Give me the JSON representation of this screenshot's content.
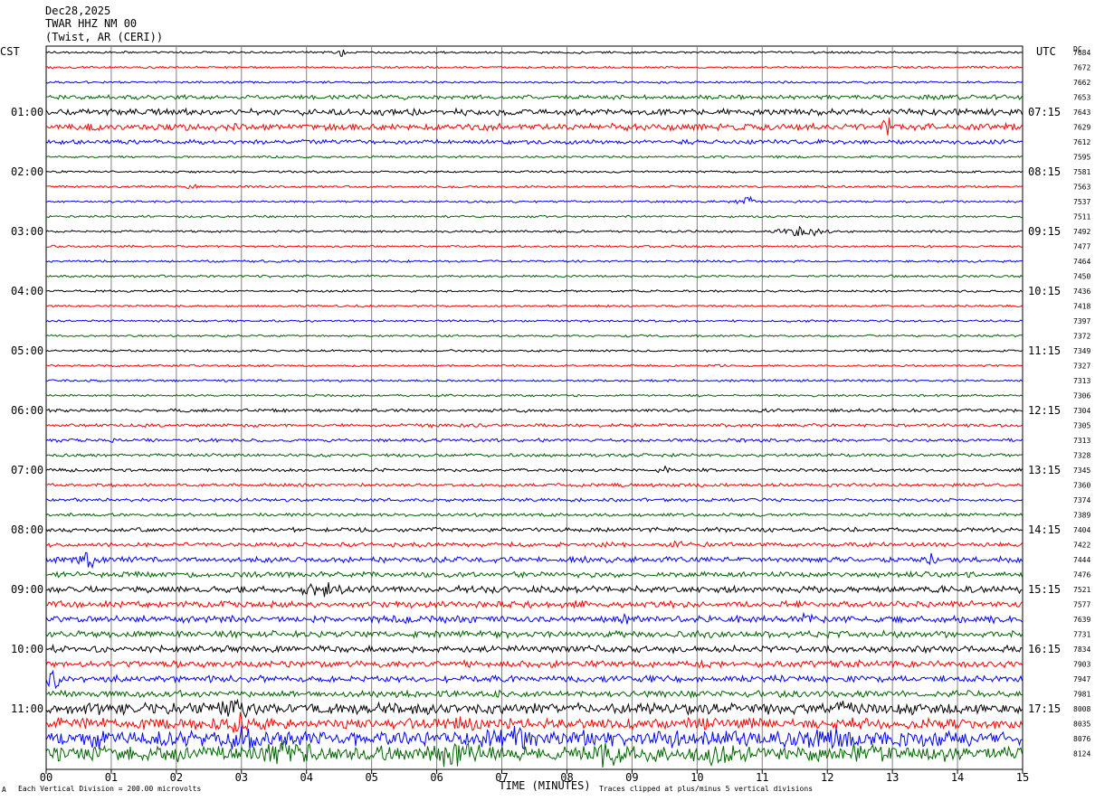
{
  "header": {
    "date": "Dec28,2025",
    "station": "TWAR HHZ NM 00",
    "location": "(Twist, AR (CERI))"
  },
  "left_zone": "CST",
  "right_zone": "UTC",
  "dc_label": "DC",
  "footer": {
    "scale": "Each Vertical Division =  200.00 microvolts",
    "clip": "Traces clipped at plus/minus 5 vertical divisions",
    "corner": "A"
  },
  "colors": {
    "cycle": [
      "#000000",
      "#ff0000",
      "#0000ff",
      "#006400"
    ],
    "grid": "#808080"
  },
  "chart_data": {
    "type": "line",
    "xlabel": "TIME (MINUTES)",
    "xlim": [
      0,
      15
    ],
    "x_ticks": [
      "00",
      "01",
      "02",
      "03",
      "04",
      "05",
      "06",
      "07",
      "08",
      "09",
      "10",
      "11",
      "12",
      "13",
      "14",
      "15"
    ],
    "left_hour_labels": [
      "01:00",
      "02:00",
      "03:00",
      "04:00",
      "05:00",
      "06:00",
      "07:00",
      "08:00",
      "09:00",
      "10:00",
      "11:00"
    ],
    "right_hour_labels": [
      "07:15",
      "08:15",
      "09:15",
      "10:15",
      "11:15",
      "12:15",
      "13:15",
      "14:15",
      "15:15",
      "16:15",
      "17:15"
    ],
    "hour_label_rows": [
      4,
      8,
      12,
      16,
      20,
      24,
      28,
      32,
      36,
      40,
      44
    ],
    "dc_offsets": [
      "7684",
      "7672",
      "7662",
      "7653",
      "7643",
      "7629",
      "7612",
      "7595",
      "7581",
      "7563",
      "7537",
      "7511",
      "7492",
      "7477",
      "7464",
      "7450",
      "7436",
      "7418",
      "7397",
      "7372",
      "7349",
      "7327",
      "7313",
      "7306",
      "7304",
      "7305",
      "7313",
      "7328",
      "7345",
      "7360",
      "7374",
      "7389",
      "7404",
      "7422",
      "7444",
      "7476",
      "7521",
      "7577",
      "7639",
      "7731",
      "7834",
      "7903",
      "7947",
      "7981",
      "8008",
      "8035",
      "8076",
      "8124"
    ],
    "noise_levels": [
      1,
      1,
      1,
      2,
      3,
      3,
      2,
      1,
      1,
      1,
      1,
      1,
      1,
      1,
      1,
      1,
      1,
      1,
      1,
      1,
      1,
      1,
      1,
      1,
      1.5,
      1.5,
      1.5,
      1.5,
      1.5,
      1.5,
      1.5,
      1.5,
      2,
      2,
      2.5,
      2.5,
      3,
      3,
      3,
      3,
      3,
      3,
      3,
      3,
      5,
      5,
      7,
      7
    ],
    "events": [
      {
        "row": 0,
        "t": 4.55,
        "amp": 6,
        "dur": 0.15
      },
      {
        "row": 5,
        "t": 0.7,
        "amp": 5,
        "dur": 0.8
      },
      {
        "row": 5,
        "t": 4.8,
        "amp": 5,
        "dur": 0.4
      },
      {
        "row": 5,
        "t": 12.9,
        "amp": 28,
        "dur": 0.1
      },
      {
        "row": 5,
        "t": 14.8,
        "amp": 6,
        "dur": 0.2
      },
      {
        "row": 9,
        "t": 2.2,
        "amp": 4,
        "dur": 0.3
      },
      {
        "row": 10,
        "t": 10.8,
        "amp": 7,
        "dur": 0.3
      },
      {
        "row": 12,
        "t": 11.6,
        "amp": 9,
        "dur": 0.6
      },
      {
        "row": 25,
        "t": 5.9,
        "amp": 4,
        "dur": 0.1
      },
      {
        "row": 25,
        "t": 7.6,
        "amp": 5,
        "dur": 0.1
      },
      {
        "row": 26,
        "t": 1.0,
        "amp": 5,
        "dur": 0.1
      },
      {
        "row": 26,
        "t": 7.6,
        "amp": 4,
        "dur": 0.1
      },
      {
        "row": 28,
        "t": 9.5,
        "amp": 6,
        "dur": 0.3
      },
      {
        "row": 29,
        "t": 8.9,
        "amp": 4,
        "dur": 0.2
      },
      {
        "row": 33,
        "t": 9.7,
        "amp": 6,
        "dur": 0.2
      },
      {
        "row": 34,
        "t": 0.65,
        "amp": 14,
        "dur": 0.3
      },
      {
        "row": 34,
        "t": 13.6,
        "amp": 9,
        "dur": 0.2
      },
      {
        "row": 36,
        "t": 4.3,
        "amp": 10,
        "dur": 0.8
      },
      {
        "row": 37,
        "t": 1.4,
        "amp": 6,
        "dur": 0.5
      },
      {
        "row": 37,
        "t": 8.2,
        "amp": 8,
        "dur": 0.3
      },
      {
        "row": 38,
        "t": 8.95,
        "amp": 18,
        "dur": 0.2
      },
      {
        "row": 38,
        "t": 11.7,
        "amp": 10,
        "dur": 0.3
      },
      {
        "row": 38,
        "t": 5.5,
        "amp": 7,
        "dur": 0.3
      },
      {
        "row": 40,
        "t": 0.3,
        "amp": 8,
        "dur": 0.1
      },
      {
        "row": 40,
        "t": 13.5,
        "amp": 6,
        "dur": 0.2
      },
      {
        "row": 41,
        "t": 11.1,
        "amp": 7,
        "dur": 0.2
      },
      {
        "row": 42,
        "t": 0.1,
        "amp": 18,
        "dur": 0.2
      },
      {
        "row": 44,
        "t": 2.9,
        "amp": 14,
        "dur": 0.8
      },
      {
        "row": 44,
        "t": 12.3,
        "amp": 12,
        "dur": 0.7
      },
      {
        "row": 45,
        "t": 3.0,
        "amp": 14,
        "dur": 0.8
      },
      {
        "row": 45,
        "t": 6.3,
        "amp": 12,
        "dur": 0.8
      },
      {
        "row": 46,
        "t": 0.8,
        "amp": 14,
        "dur": 0.4
      },
      {
        "row": 46,
        "t": 3.0,
        "amp": 16,
        "dur": 0.8
      },
      {
        "row": 46,
        "t": 7.2,
        "amp": 16,
        "dur": 1.2
      },
      {
        "row": 46,
        "t": 9.6,
        "amp": 12,
        "dur": 0.8
      },
      {
        "row": 46,
        "t": 11.8,
        "amp": 16,
        "dur": 1.5
      },
      {
        "row": 47,
        "t": 3.7,
        "amp": 20,
        "dur": 1.0
      },
      {
        "row": 47,
        "t": 6.3,
        "amp": 22,
        "dur": 1.0
      },
      {
        "row": 47,
        "t": 8.6,
        "amp": 18,
        "dur": 0.8
      },
      {
        "row": 47,
        "t": 10.3,
        "amp": 16,
        "dur": 1.0
      },
      {
        "row": 47,
        "t": 12.5,
        "amp": 16,
        "dur": 0.8
      }
    ]
  }
}
